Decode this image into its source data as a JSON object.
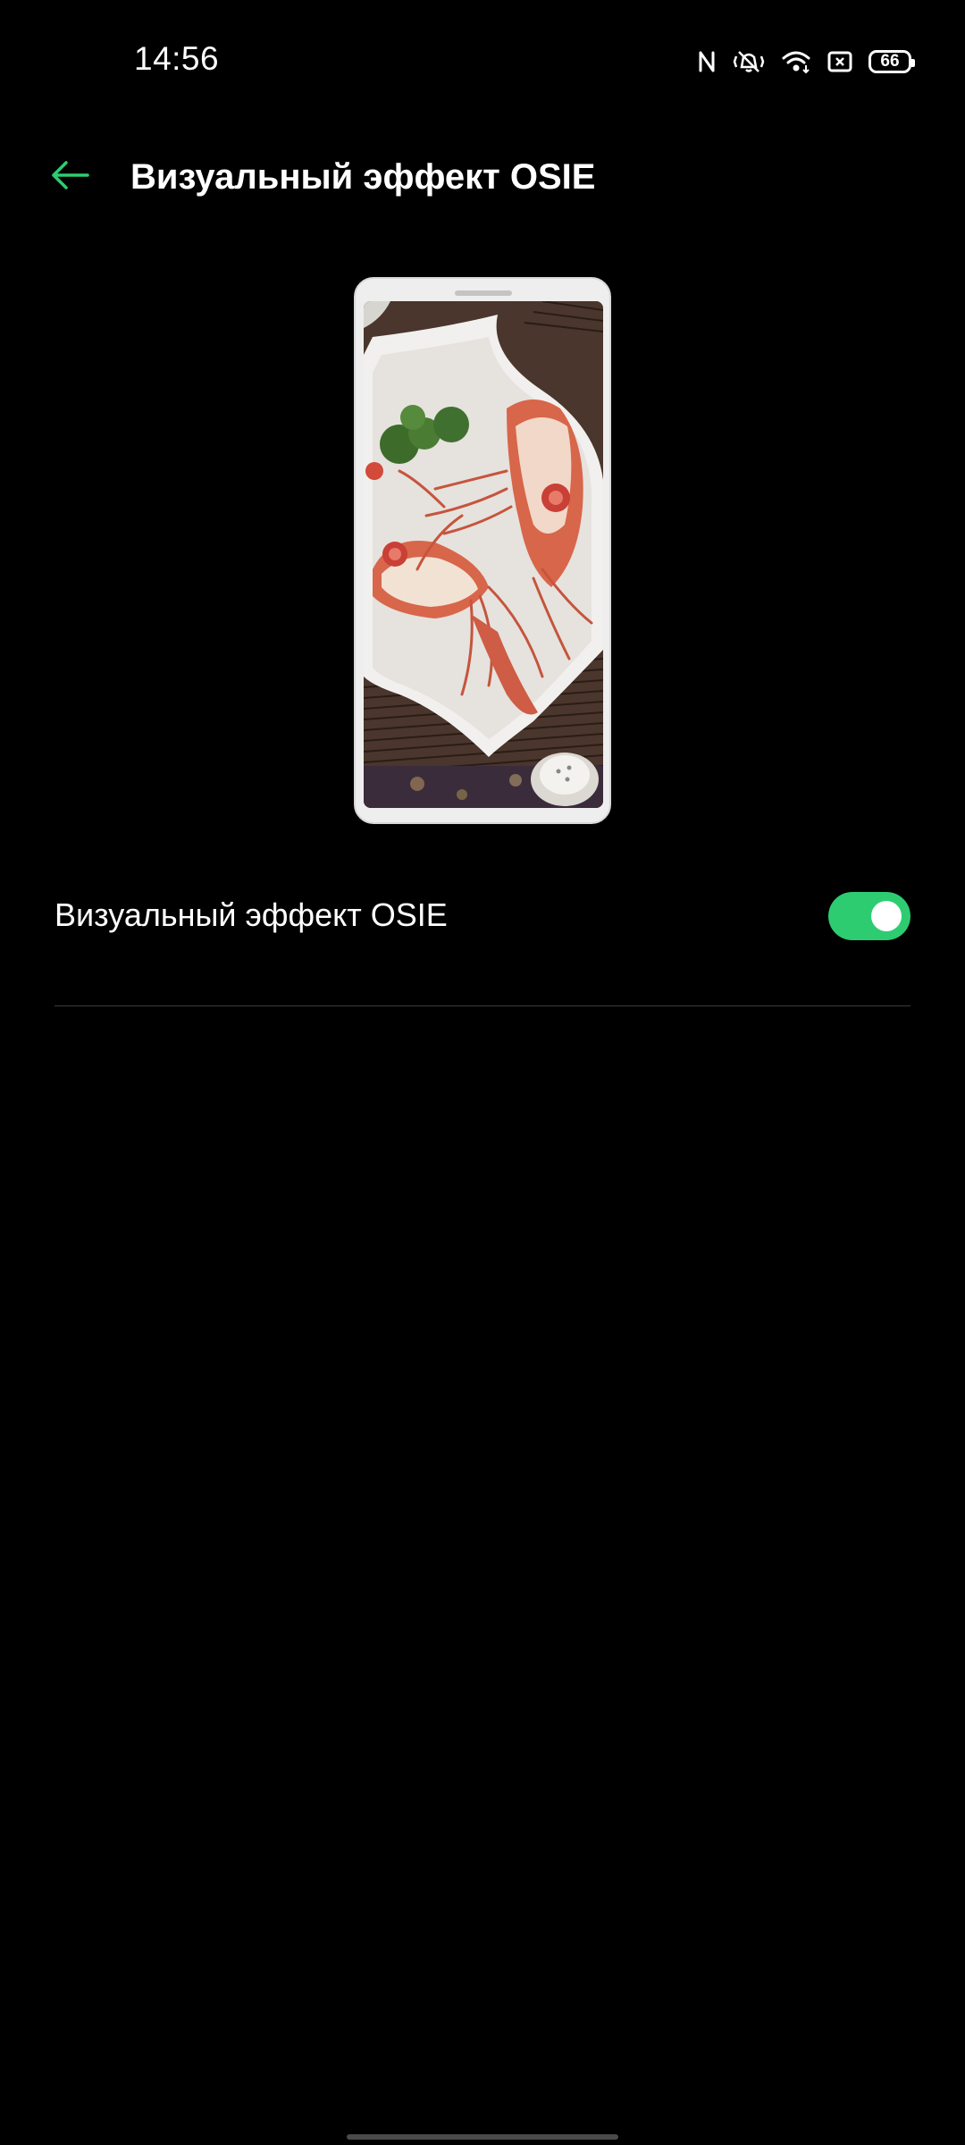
{
  "status_bar": {
    "time": "14:56",
    "icons": [
      "nfc-icon",
      "vibrate-icon",
      "wifi-icon",
      "sim-icon",
      "battery-icon"
    ],
    "battery_level": "66"
  },
  "toolbar": {
    "title": "Визуальный эффект OSIE",
    "back_icon": "arrow-left-icon"
  },
  "preview": {
    "image": "lobster-dish-preview"
  },
  "settings": {
    "osie_toggle": {
      "label": "Визуальный эффект OSIE",
      "enabled": true
    }
  },
  "colors": {
    "accent": "#2ecc71",
    "background": "#000000",
    "text": "#ffffff",
    "divider": "#3c3c3c"
  }
}
